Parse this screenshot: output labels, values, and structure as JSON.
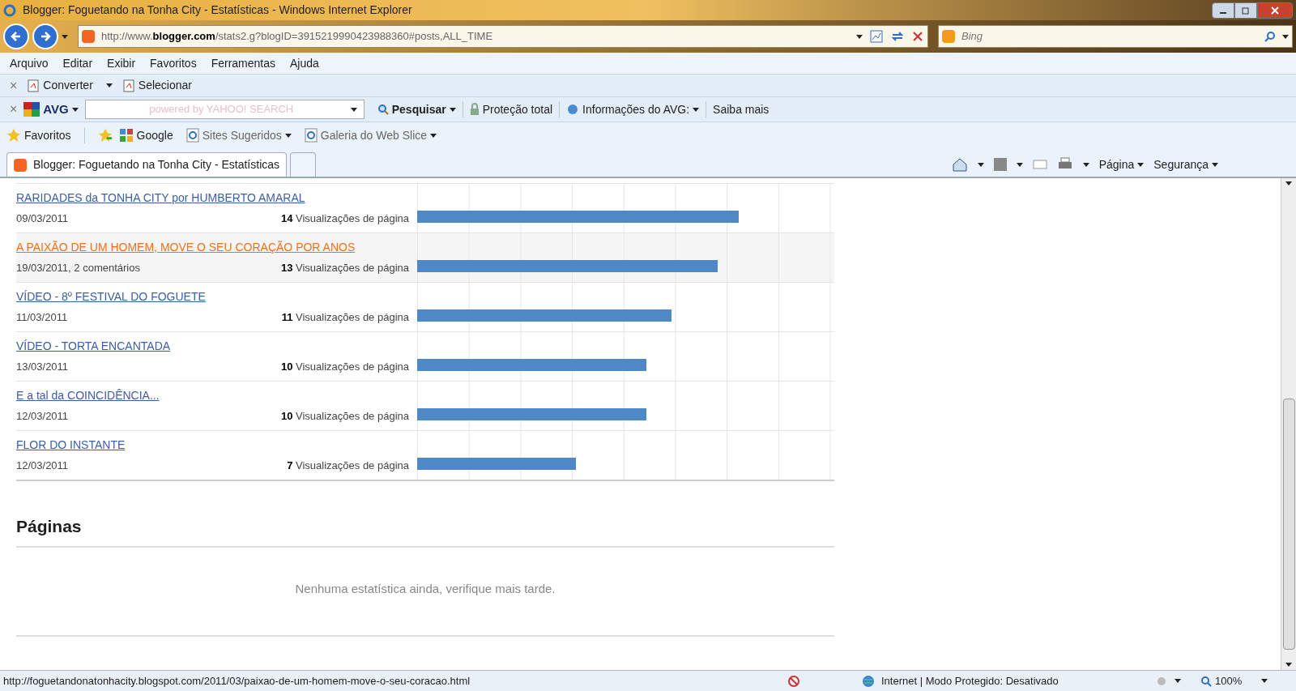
{
  "window": {
    "title": "Blogger: Foguetando na Tonha City - Estatísticas - Windows Internet Explorer"
  },
  "address_bar": {
    "prefix": "http://www.",
    "domain": "blogger.com",
    "path": "/stats2.g?blogID=3915219990423988360#posts,ALL_TIME"
  },
  "search_box": {
    "placeholder": "Bing"
  },
  "menu": [
    "Arquivo",
    "Editar",
    "Exibir",
    "Favoritos",
    "Ferramentas",
    "Ajuda"
  ],
  "toolbar": {
    "close": "×",
    "items": [
      "Converter",
      "Selecionar"
    ]
  },
  "avg_toolbar": {
    "close": "×",
    "brand": "AVG",
    "search_placeholder": "powered by YAHOO! SEARCH",
    "search_button": "Pesquisar",
    "items": [
      "Proteção total",
      "Informações do AVG:",
      "Saiba mais"
    ]
  },
  "favorites_bar": {
    "favorites": "Favoritos",
    "items": [
      "Google",
      "Sites Sugeridos",
      "Galeria do Web Slice"
    ]
  },
  "tabs": [
    {
      "label": "Blogger: Foguetando na Tonha City - Estatísticas",
      "selected": true
    }
  ],
  "command_bar": [
    "Página",
    "Segurança"
  ],
  "posts": [
    {
      "title": "RARIDADES da TONHA CITY por HUMBERTO AMARAL",
      "meta": "09/03/2011",
      "count": "14",
      "unit": "Visualizações de página",
      "level": 0.77,
      "highlighted": false
    },
    {
      "title": "A PAIXÃO DE UM HOMEM, MOVE O SEU CORAÇÃO POR ANOS",
      "meta": "19/03/2011, 2 comentários",
      "count": "13",
      "unit": "Visualizações de página",
      "level": 0.72,
      "highlighted": true
    },
    {
      "title": "VÍDEO - 8º FESTIVAL DO FOGUETE",
      "meta": "11/03/2011",
      "count": "11",
      "unit": "Visualizações de página",
      "level": 0.61,
      "highlighted": false
    },
    {
      "title": "VÍDEO - TORTA ENCANTADA",
      "meta": "13/03/2011",
      "count": "10",
      "unit": "Visualizações de página",
      "level": 0.55,
      "highlighted": false
    },
    {
      "title": "E a tal da COINCIDÊNCIA...",
      "meta": "12/03/2011",
      "count": "10",
      "unit": "Visualizações de página",
      "level": 0.55,
      "highlighted": false
    },
    {
      "title": "FLOR DO INSTANTE",
      "meta": "12/03/2011",
      "count": "7",
      "unit": "Visualizações de página",
      "level": 0.38,
      "highlighted": false
    }
  ],
  "pages_section": {
    "heading": "Páginas",
    "empty": "Nenhuma estatística ainda, verifique mais tarde."
  },
  "status_bar": {
    "url": "http://foguetandonatonhacity.blogspot.com/2011/03/paixao-de-um-homem-move-o-seu-coracao.html",
    "zone": "Internet | Modo Protegido: Desativado",
    "zoom": "100%"
  }
}
